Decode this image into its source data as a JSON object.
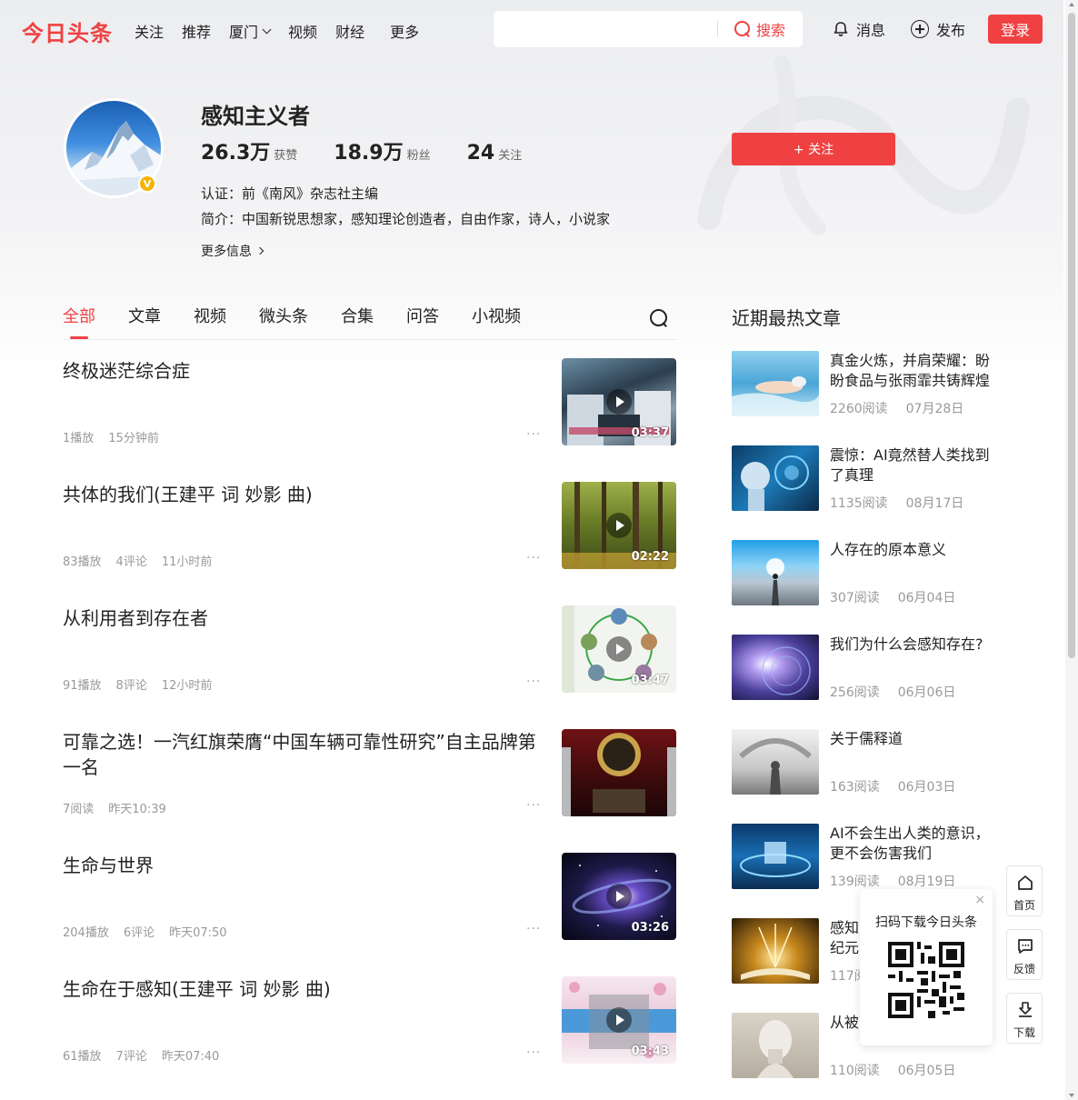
{
  "header": {
    "logo": "今日头条",
    "nav": [
      "关注",
      "推荐",
      "厦门",
      "视频",
      "财经",
      "更多"
    ],
    "search": {
      "placeholder": "",
      "button": "搜索"
    },
    "messages": "消息",
    "publish": "发布",
    "login": "登录"
  },
  "profile": {
    "name": "感知主义者",
    "stats": [
      {
        "value": "26.3万",
        "label": "获赞"
      },
      {
        "value": "18.9万",
        "label": "粉丝"
      },
      {
        "value": "24",
        "label": "关注"
      }
    ],
    "cert": "认证：前《南风》杂志社主编",
    "intro": "简介：中国新锐思想家，感知理论创造者，自由作家，诗人，小说家",
    "more_info": "更多信息",
    "follow_button": "+ 关注",
    "verified_badge": "V"
  },
  "tabs": [
    "全部",
    "文章",
    "视频",
    "微头条",
    "合集",
    "问答",
    "小视频"
  ],
  "feed": [
    {
      "title": "终极迷茫综合症",
      "meta": [
        "1播放",
        "15分钟前"
      ],
      "duration": "03:37"
    },
    {
      "title": "共体的我们(王建平 词 妙影 曲)",
      "meta": [
        "83播放",
        "4评论",
        "11小时前"
      ],
      "duration": "02:22"
    },
    {
      "title": "从利用者到存在者",
      "meta": [
        "91播放",
        "8评论",
        "12小时前"
      ],
      "duration": "03:47"
    },
    {
      "title": "可靠之选！一汽红旗荣膺“中国车辆可靠性研究”自主品牌第一名",
      "meta": [
        "7阅读",
        "昨天10:39"
      ],
      "duration": ""
    },
    {
      "title": "生命与世界",
      "meta": [
        "204播放",
        "6评论",
        "昨天07:50"
      ],
      "duration": "03:26"
    },
    {
      "title": "生命在于感知(王建平 词 妙影 曲)",
      "meta": [
        "61播放",
        "7评论",
        "昨天07:40"
      ],
      "duration": "03:43"
    }
  ],
  "sidebar": {
    "title": "近期最热文章",
    "items": [
      {
        "title": "真金火炼，并肩荣耀：盼盼食品与张雨霏共铸辉煌",
        "reads": "2260阅读",
        "date": "07月28日"
      },
      {
        "title": "震惊：AI竟然替人类找到了真理",
        "reads": "1135阅读",
        "date": "08月17日"
      },
      {
        "title": "人存在的原本意义",
        "reads": "307阅读",
        "date": "06月04日"
      },
      {
        "title": "我们为什么会感知存在?",
        "reads": "256阅读",
        "date": "06月06日"
      },
      {
        "title": "关于儒释道",
        "reads": "163阅读",
        "date": "06月03日"
      },
      {
        "title": "AI不会生出人类的意识，更不会伤害我们",
        "reads": "139阅读",
        "date": "08月19日"
      },
      {
        "title": "感知",
        "title2": "纪元",
        "reads": "117阅",
        "date": ""
      },
      {
        "title": "从被",
        "reads": "110阅读",
        "date": "06月05日"
      }
    ]
  },
  "qr_popup": {
    "text": "扫码下载今日头条",
    "close": "×"
  },
  "float_buttons": [
    "首页",
    "反馈",
    "下载"
  ],
  "colors": {
    "accent": "#f04142",
    "meta": "#999999",
    "text": "#222222"
  }
}
